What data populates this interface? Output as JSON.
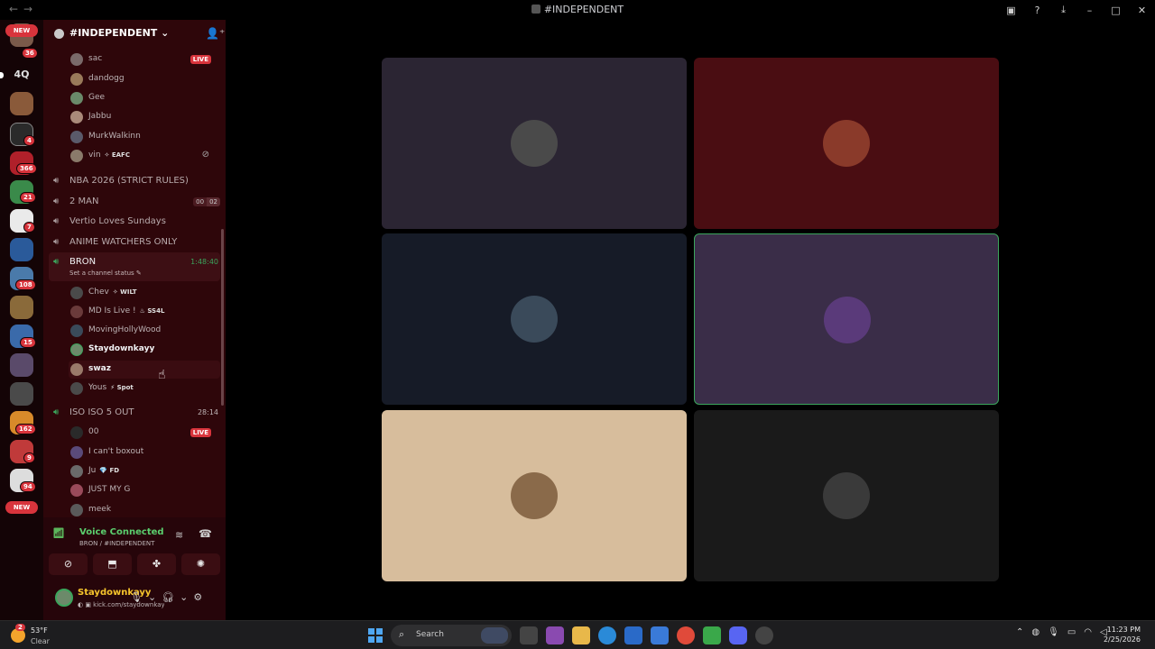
{
  "window": {
    "title": "#INDEPENDENT"
  },
  "server": {
    "name": "#INDEPENDENT"
  },
  "rail": {
    "text_server": "4Q",
    "new_label": "NEW",
    "badges": [
      "36",
      "4",
      "366",
      "21",
      "7",
      "108",
      "15",
      "162",
      "9",
      "94"
    ]
  },
  "top_members": [
    {
      "name": "sac",
      "live": "LIVE"
    },
    {
      "name": "dandogg"
    },
    {
      "name": "Gee"
    },
    {
      "name": "Jabbu"
    },
    {
      "name": "MurkWalkinn"
    },
    {
      "name": "vin",
      "tag": "EAFC"
    }
  ],
  "voice_channels": [
    {
      "name": "NBA 2026 (STRICT RULES)"
    },
    {
      "name": "2 MAN",
      "count_a": "00",
      "count_b": "02"
    },
    {
      "name": "Vertio Loves Sundays"
    },
    {
      "name": "ANIME WATCHERS ONLY"
    }
  ],
  "active_channel": {
    "name": "BRON",
    "timer": "1:48:40",
    "status": "Set a channel status",
    "members": [
      {
        "name": "Chev",
        "tag": "WILT"
      },
      {
        "name": "MD Is Live !",
        "tag": "SS4L"
      },
      {
        "name": "MovingHollyWood"
      },
      {
        "name": "Staydownkayy"
      },
      {
        "name": "swaz"
      },
      {
        "name": "Yous",
        "tag": "Spot"
      }
    ]
  },
  "iso_channel": {
    "name": "ISO ISO 5 OUT",
    "timer": "28:14",
    "members": [
      {
        "name": "00",
        "live": "LIVE"
      },
      {
        "name": "I can't boxout"
      },
      {
        "name": "Ju",
        "tag": "FD"
      },
      {
        "name": "JUST MY G"
      },
      {
        "name": "meek"
      }
    ]
  },
  "voice_panel": {
    "title": "Voice Connected",
    "subtitle": "BRON / #INDEPENDENT"
  },
  "user_panel": {
    "name": "Staydownkayy",
    "status": "kick.com/staydownkayy"
  },
  "taskbar": {
    "weather_badge": "2",
    "temp": "53°F",
    "condition": "Clear",
    "search_label": "Search",
    "time": "11:23 PM",
    "date": "2/25/2026"
  },
  "colors": {
    "sidebar_bg": "#2e060a",
    "rail_bg": "#140406",
    "accent_green": "#3ba55c",
    "live_red": "#d8343c"
  }
}
